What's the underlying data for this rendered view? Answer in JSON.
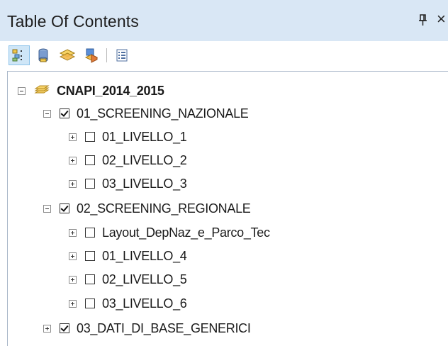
{
  "panel": {
    "title": "Table Of Contents",
    "pin_glyph": "ꟷ",
    "close_glyph": "×"
  },
  "toolbar": {
    "buttons": [
      {
        "name": "list-by-drawing-order-icon"
      },
      {
        "name": "list-by-source-icon"
      },
      {
        "name": "list-by-visibility-icon"
      },
      {
        "name": "list-by-selection-icon"
      },
      {
        "name": "options-icon"
      }
    ]
  },
  "tree": {
    "root": {
      "label": "CNAPI_2014_2015",
      "expanded": true
    },
    "groups": [
      {
        "label": "01_SCREENING_NAZIONALE",
        "checked": true,
        "expanded": true,
        "children": [
          {
            "label": "01_LIVELLO_1",
            "checked": false
          },
          {
            "label": "02_LIVELLO_2",
            "checked": false
          },
          {
            "label": "03_LIVELLO_3",
            "checked": false
          }
        ]
      },
      {
        "label": "02_SCREENING_REGIONALE",
        "checked": true,
        "expanded": true,
        "children": [
          {
            "label": "Layout_DepNaz_e_Parco_Tec",
            "checked": false
          },
          {
            "label": "01_LIVELLO_4",
            "checked": false
          },
          {
            "label": "02_LIVELLO_5",
            "checked": false
          },
          {
            "label": "03_LIVELLO_6",
            "checked": false
          }
        ]
      },
      {
        "label": "03_DATI_DI_BASE_GENERICI",
        "checked": true,
        "expanded": false,
        "children": []
      }
    ]
  }
}
